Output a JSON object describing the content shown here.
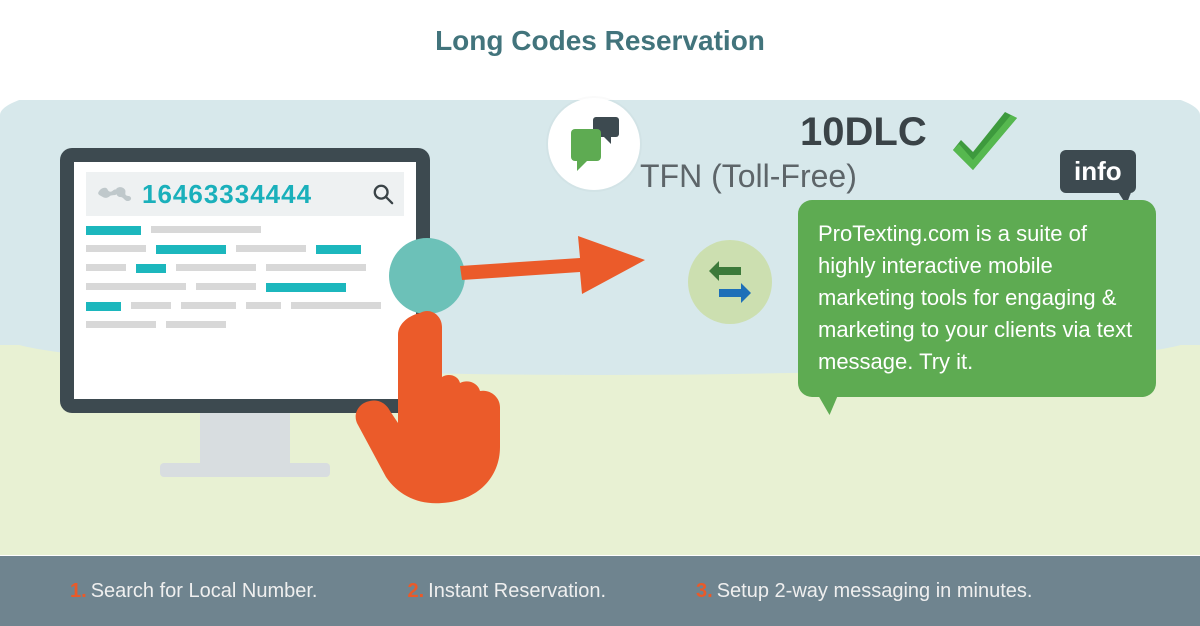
{
  "title": "Long Codes Reservation",
  "search": {
    "number": "16463334444"
  },
  "labels": {
    "dlc": "10DLC",
    "tfn": "TFN (Toll-Free)",
    "info": "info"
  },
  "bubble_text": "ProTexting.com is a suite of highly interactive mobile marketing tools for engaging & marketing to your clients via text message. Try it.",
  "steps": [
    {
      "num": "1.",
      "text": "Search for Local Number."
    },
    {
      "num": "2.",
      "text": "Instant Reservation."
    },
    {
      "num": "3.",
      "text": "Setup 2-way messaging in minutes."
    }
  ]
}
